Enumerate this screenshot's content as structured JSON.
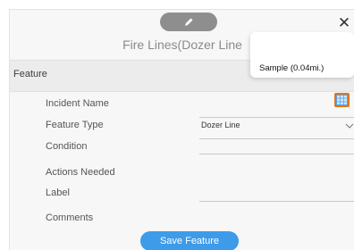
{
  "header": {
    "title": "Fire Lines(Dozer Line",
    "close_label": "✕"
  },
  "section": {
    "label": "Feature"
  },
  "fields": [
    {
      "label": "Incident Name",
      "value": ""
    },
    {
      "label": "Feature Type",
      "value": "Dozer Line"
    },
    {
      "label": "Condition",
      "value": ""
    },
    {
      "label": "Actions Needed",
      "value": ""
    },
    {
      "label": "Label",
      "value": ""
    },
    {
      "label": "Comments",
      "value": ""
    }
  ],
  "save_label": "Save Feature",
  "tooltip": {
    "text": "Sample (0.04mi.)"
  },
  "icons": {
    "edit": "pencil-icon",
    "close": "close-icon",
    "dropdown": "chevron-down-icon",
    "map": "map-grid-icon"
  },
  "colors": {
    "accent_blue": "#3d9be9",
    "map_button": "#e3741c",
    "edit_pill": "#8e8e8e"
  }
}
